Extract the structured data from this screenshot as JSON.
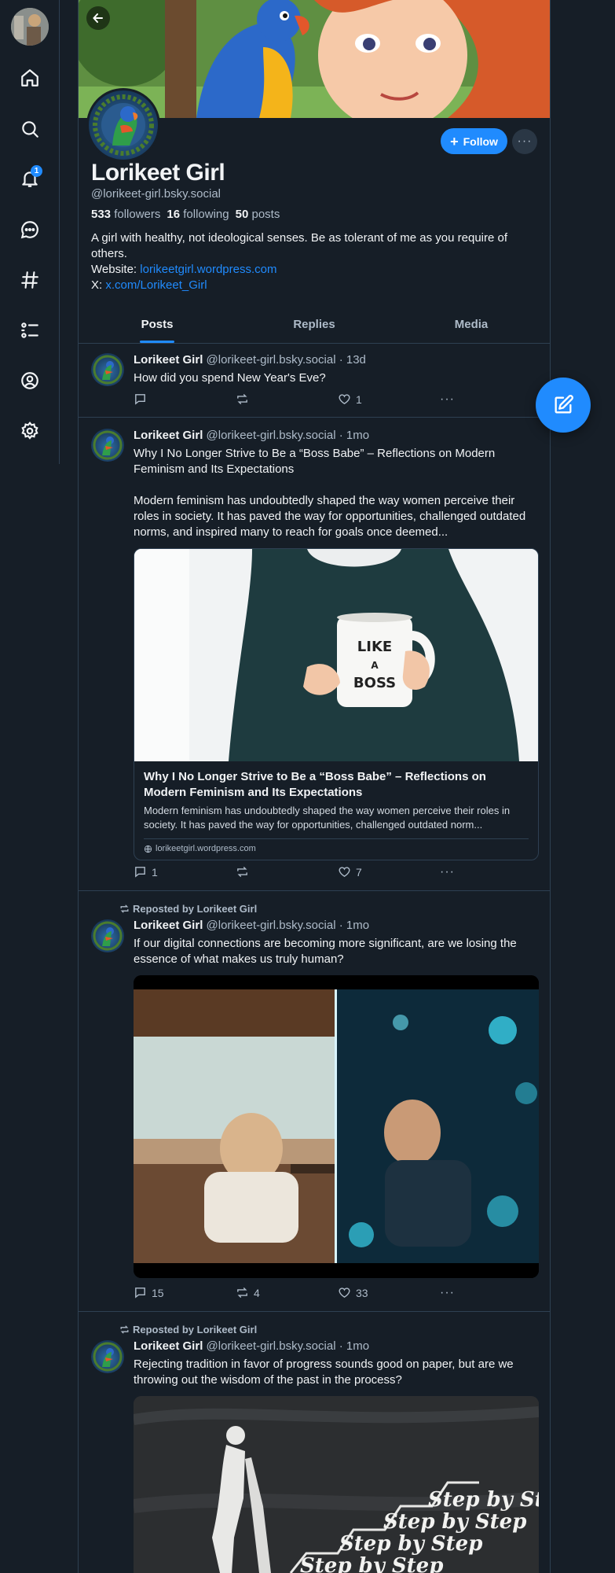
{
  "nav": {
    "notification_count": "1",
    "icons": [
      "home-icon",
      "search-icon",
      "bell-icon",
      "chat-icon",
      "hashtag-icon",
      "list-icon",
      "profile-icon",
      "settings-icon"
    ]
  },
  "profile": {
    "display_name": "Lorikeet Girl",
    "handle": "@lorikeet-girl.bsky.social",
    "followers_count": "533",
    "followers_label": "followers",
    "following_count": "16",
    "following_label": "following",
    "posts_count": "50",
    "posts_label": "posts",
    "bio_line": "A girl with healthy, not ideological senses. Be as tolerant of me as you require of others.",
    "website_label": "Website:",
    "website_link": "lorikeetgirl.wordpress.com",
    "x_label": "X:",
    "x_link": "x.com/Lorikeet_Girl",
    "follow_label": "Follow",
    "more_label": "···"
  },
  "tabs": [
    {
      "label": "Posts",
      "active": true
    },
    {
      "label": "Replies",
      "active": false
    },
    {
      "label": "Media",
      "active": false
    }
  ],
  "posts": [
    {
      "name": "Lorikeet Girl",
      "handle": "@lorikeet-girl.bsky.social",
      "time": "· 13d",
      "text": "How did you spend New Year's Eve?",
      "replies": "",
      "reposts": "",
      "likes": "1"
    },
    {
      "name": "Lorikeet Girl",
      "handle": "@lorikeet-girl.bsky.social",
      "time": "· 1mo",
      "text": "Why I No Longer Strive to Be a “Boss Babe” – Reflections on Modern Feminism and Its Expectations",
      "text2": "Modern feminism has undoubtedly shaped the way women perceive their roles in society. It has paved the way for opportunities, challenged outdated norms, and inspired many to reach for goals once deemed...",
      "embed_title": "Why I No Longer Strive to Be a “Boss Babe” – Reflections on Modern Feminism and Its Expectations",
      "embed_desc": "Modern feminism has undoubtedly shaped the way women perceive their roles in society. It has paved the way for opportunities, challenged outdated norm...",
      "embed_domain": "lorikeetgirl.wordpress.com",
      "mug_text": "LIKE A BOSS",
      "replies": "1",
      "reposts": "",
      "likes": "7"
    },
    {
      "repost_label": "Reposted by Lorikeet Girl",
      "name": "Lorikeet Girl",
      "handle": "@lorikeet-girl.bsky.social",
      "time": "· 1mo",
      "text": "If our digital connections are becoming more significant, are we losing the essence of what makes us truly human?",
      "replies": "15",
      "reposts": "4",
      "likes": "33"
    },
    {
      "repost_label": "Reposted by Lorikeet Girl",
      "name": "Lorikeet Girl",
      "handle": "@lorikeet-girl.bsky.social",
      "time": "· 1mo",
      "text": "Rejecting tradition in favor of progress sounds good on paper, but are we throwing out the wisdom of the past in the process?",
      "image_text": [
        "Step by Step",
        "Step by Step",
        "Step by Step",
        "Step by Step"
      ]
    }
  ],
  "colors": {
    "background": "#161e27",
    "accent": "#208bfe",
    "muted_text": "#aebbc9",
    "border": "#2e4052"
  }
}
